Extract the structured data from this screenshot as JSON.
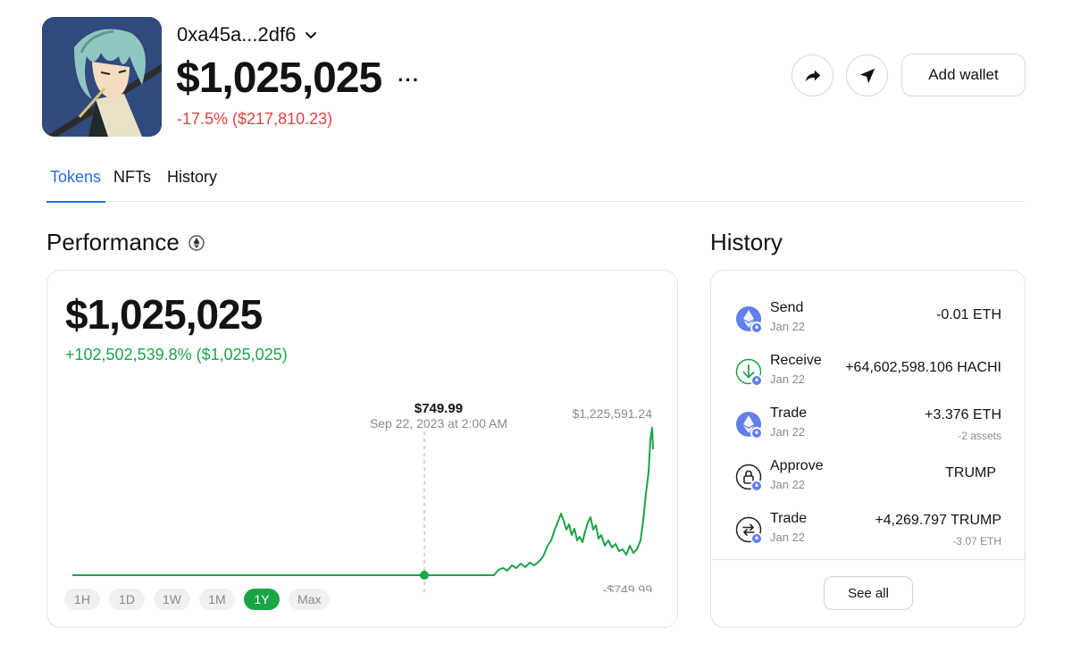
{
  "header": {
    "address": "0xa45a...2df6",
    "balance": "$1,025,025",
    "more": "···",
    "change": "-17.5% ($217,810.23)",
    "add_wallet_label": "Add wallet"
  },
  "tabs": [
    {
      "label": "Tokens",
      "active": true
    },
    {
      "label": "NFTs",
      "active": false
    },
    {
      "label": "History",
      "active": false
    }
  ],
  "performance": {
    "title": "Performance",
    "value": "$1,025,025",
    "change": "+102,502,539.8% ($1,025,025)",
    "chart_high_label": "$1,225,591.24",
    "chart_low_label": "-$749.99",
    "tooltip_value": "$749.99",
    "tooltip_date": "Sep 22, 2023 at 2:00 AM",
    "ranges": [
      {
        "label": "1H",
        "active": false
      },
      {
        "label": "1D",
        "active": false
      },
      {
        "label": "1W",
        "active": false
      },
      {
        "label": "1M",
        "active": false
      },
      {
        "label": "1Y",
        "active": true
      },
      {
        "label": "Max",
        "active": false
      }
    ],
    "line_color": "#1aa546"
  },
  "history": {
    "title": "History",
    "items": [
      {
        "type": "Send",
        "date": "Jan 22",
        "amount": "-0.01 ETH",
        "sub": "",
        "icon": "eth-icon"
      },
      {
        "type": "Receive",
        "date": "Jan 22",
        "amount": "+64,602,598.106 HACHI",
        "sub": "",
        "icon": "receive-icon"
      },
      {
        "type": "Trade",
        "date": "Jan 22",
        "amount": "+3.376 ETH",
        "sub": "-2 assets",
        "icon": "eth-icon"
      },
      {
        "type": "Approve",
        "date": "Jan 22",
        "amount": "TRUMP",
        "sub": "",
        "icon": "lock-icon"
      },
      {
        "type": "Trade",
        "date": "Jan 22",
        "amount": "+4,269.797 TRUMP",
        "sub": "-3.07 ETH",
        "icon": "swap-icon"
      }
    ],
    "see_all_label": "See all"
  },
  "colors": {
    "accent_blue": "#2a6ae0",
    "positive_green": "#1aa546",
    "negative_red": "#e84142",
    "eth_purple": "#627eea"
  }
}
